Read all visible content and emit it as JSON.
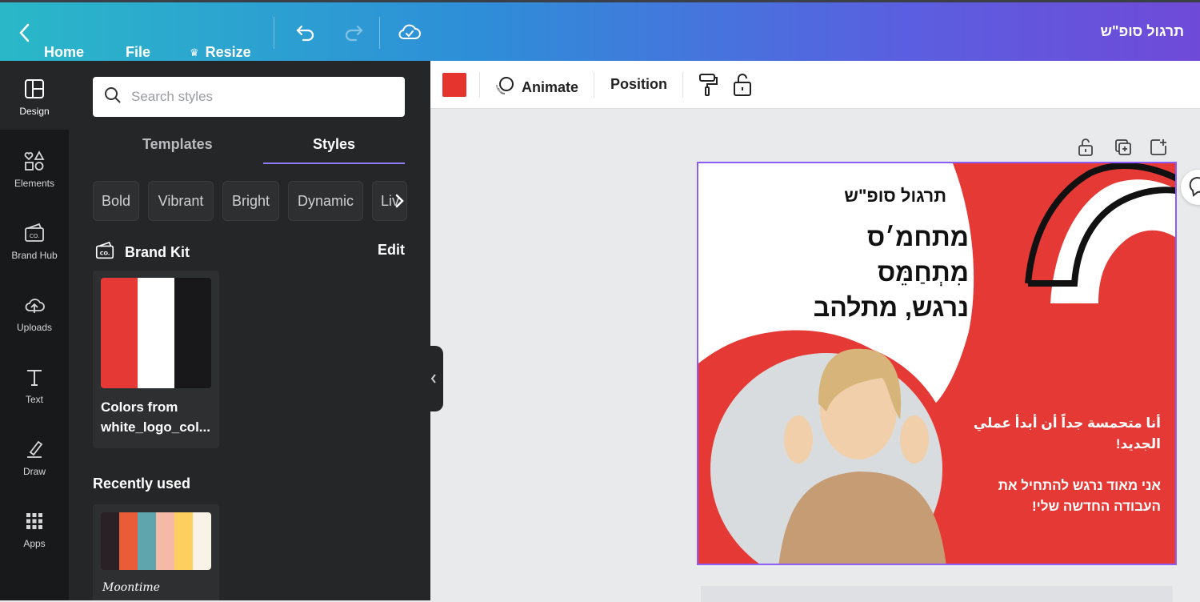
{
  "topbar": {
    "home_label": "Home",
    "file_label": "File",
    "resize_label": "Resize",
    "document_title": "תרגול סופ\"ש"
  },
  "rail": {
    "items": [
      {
        "label": "Design",
        "icon": "layout-icon"
      },
      {
        "label": "Elements",
        "icon": "shapes-icon"
      },
      {
        "label": "Brand Hub",
        "icon": "brand-icon"
      },
      {
        "label": "Uploads",
        "icon": "cloud-upload-icon"
      },
      {
        "label": "Text",
        "icon": "text-icon"
      },
      {
        "label": "Draw",
        "icon": "pen-icon"
      },
      {
        "label": "Apps",
        "icon": "grid-icon"
      }
    ]
  },
  "panel": {
    "search_placeholder": "Search styles",
    "tabs": [
      "Templates",
      "Styles"
    ],
    "active_tab": "Styles",
    "chips": [
      "Bold",
      "Vibrant",
      "Bright",
      "Dynamic",
      "Liv"
    ],
    "brand_kit_label": "Brand Kit",
    "edit_label": "Edit",
    "kit": {
      "name": "Colors from white_logo_col...",
      "colors": [
        "#e53935",
        "#ffffff",
        "#18181a"
      ]
    },
    "recently_used_label": "Recently used",
    "recent": {
      "name": "Moontime",
      "colors": [
        "#2a2126",
        "#ea5b38",
        "#5fa5ad",
        "#f6b9a6",
        "#fdcf5e",
        "#f8f3e6"
      ]
    }
  },
  "context_toolbar": {
    "selected_color": "#e53935",
    "animate_label": "Animate",
    "position_label": "Position"
  },
  "design": {
    "title": "תרגול סופ\"ש",
    "lines": [
      "מתחמ׳ס",
      "מִתְחַמֵּס",
      "נרגש, מתלהב"
    ],
    "arabic_text": "أنا متحمسة جداً أن أبدأ عملي الجديد!",
    "hebrew_text": "אני מאוד נרגש להתחיל את העבודה החדשה שלי!"
  },
  "colors": {
    "accent": "#8b5cf6",
    "brand_red": "#e53935"
  }
}
